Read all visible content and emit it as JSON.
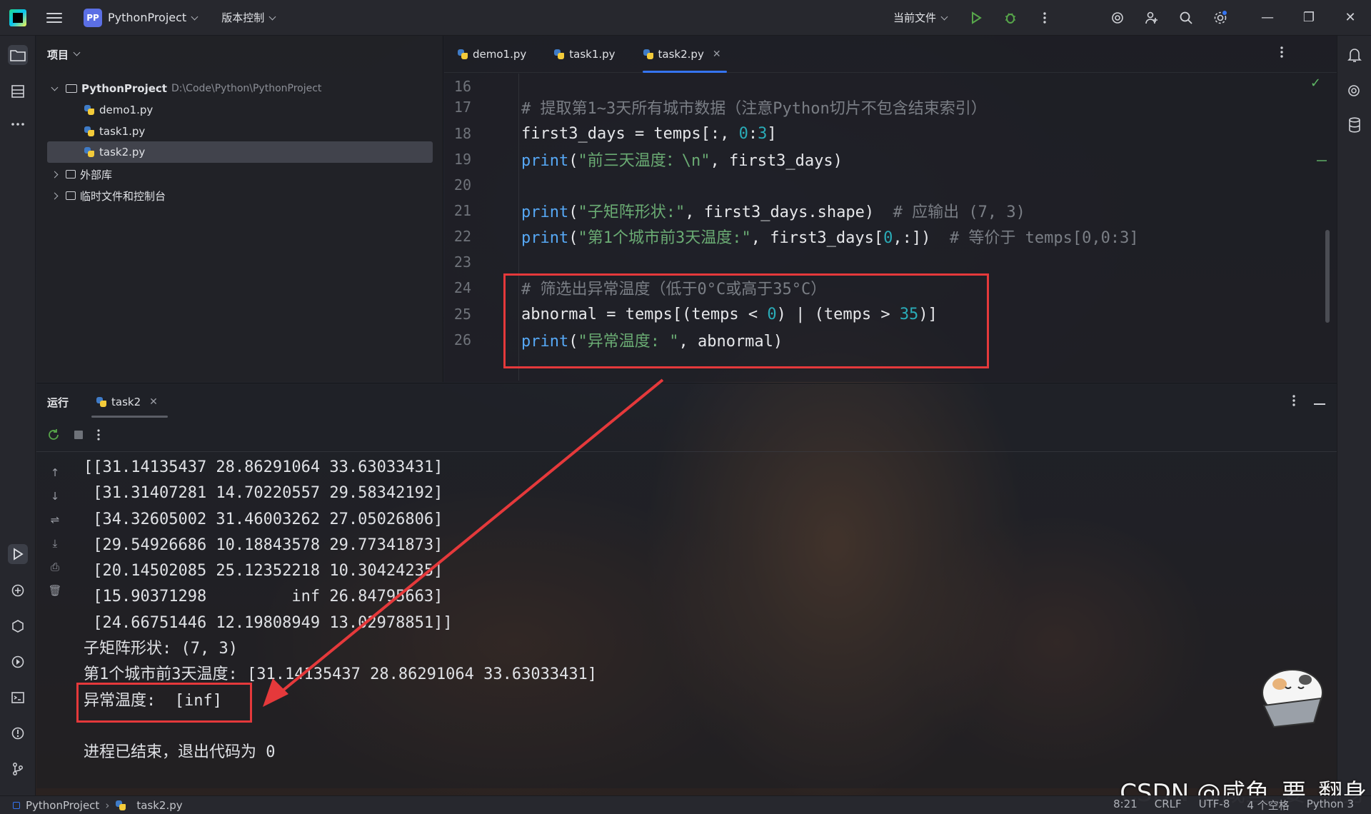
{
  "topbar": {
    "project_badge": "PP",
    "project_name": "PythonProject",
    "vcs": "版本控制",
    "current_file": "当前文件"
  },
  "project_panel": {
    "title": "项目",
    "root_name": "PythonProject",
    "root_path": "D:\\Code\\Python\\PythonProject",
    "files": [
      "demo1.py",
      "task1.py",
      "task2.py"
    ],
    "external_libs": "外部库",
    "scratches": "临时文件和控制台"
  },
  "editor": {
    "tabs": [
      "demo1.py",
      "task1.py",
      "task2.py"
    ],
    "active_tab": "task2.py",
    "line_numbers": [
      "16",
      "17",
      "18",
      "19",
      "20",
      "21",
      "22",
      "23",
      "24",
      "25",
      "26"
    ]
  },
  "run_panel": {
    "title": "运行",
    "tab": "task2",
    "output": [
      "[[31.14135437 28.86291064 33.63033431]",
      " [31.31407281 14.70220557 29.58342192]",
      " [34.32605002 31.46003262 27.05026806]",
      " [29.54926686 10.18843578 29.77341873]",
      " [20.14502085 25.12352218 10.30424235]",
      " [15.90371298         inf 26.84795663]",
      " [24.66751446 12.19808949 13.02978851]]",
      "子矩阵形状: (7, 3)",
      "第1个城市前3天温度: [31.14135437 28.86291064 33.63033431]",
      "异常温度:  [inf]",
      "",
      "进程已结束，退出代码为 0"
    ]
  },
  "status_bar": {
    "project": "PythonProject",
    "file": "task2.py",
    "position": "8:21",
    "line_sep": "CRLF",
    "encoding": "UTF-8",
    "indent": "4 个空格",
    "interpreter": "Python 3"
  },
  "watermark": "CSDN @咸鱼_要_翻身",
  "colors": {
    "accent": "#3574f0",
    "highlight_box": "#e5393b",
    "string": "#6aab73",
    "number": "#2aacb8",
    "comment": "#7a7e85"
  }
}
